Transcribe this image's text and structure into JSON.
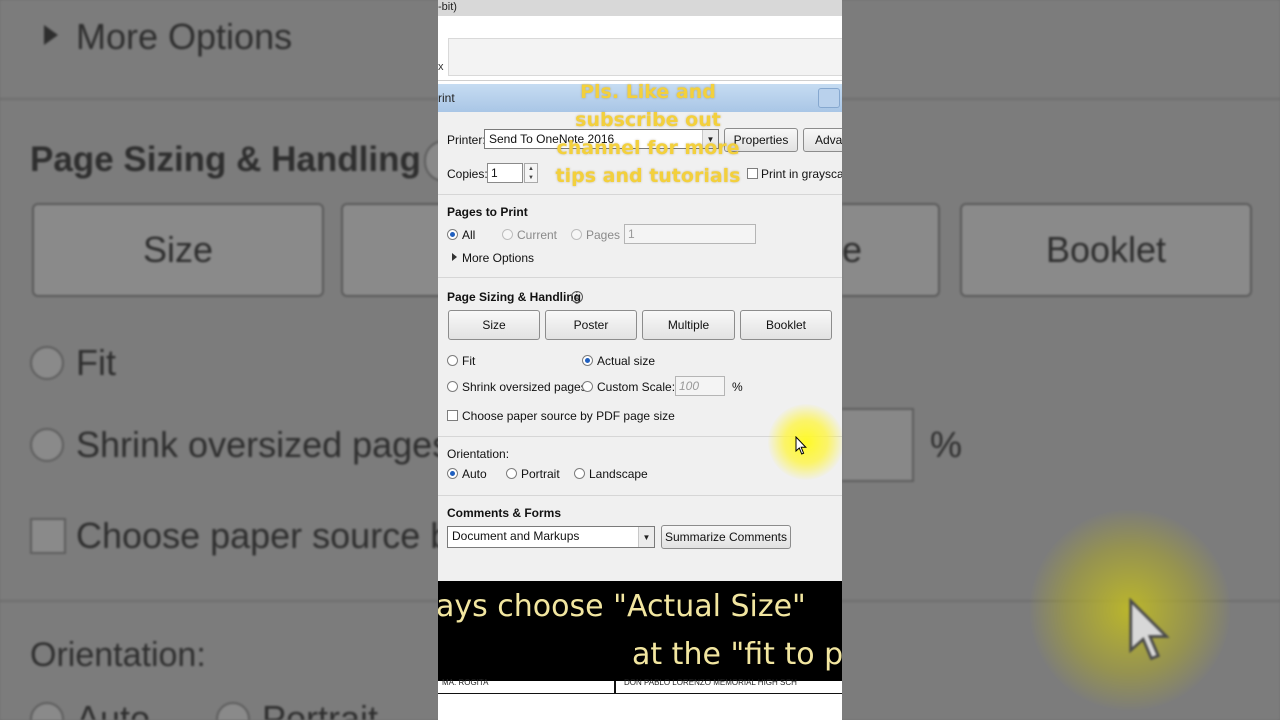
{
  "window": {
    "title_fragment": "-bit)",
    "toolbar_edge": "x"
  },
  "dialog": {
    "title_fragment": "rint",
    "printer": {
      "label": "Printer:",
      "value": "Send To OneNote 2016",
      "properties_label": "Properties",
      "advanced_label": "Adva"
    },
    "copies": {
      "label": "Copies:",
      "value": "1"
    },
    "grayscale_label": "Print in grayscale",
    "pages_to_print": {
      "heading": "Pages to Print",
      "all_label": "All",
      "current_label": "Current",
      "pages_label": "Pages",
      "pages_value": "1",
      "more_options_label": "More Options"
    },
    "page_sizing": {
      "heading": "Page Sizing & Handling",
      "info_glyph": "i",
      "buttons": [
        "Size",
        "Poster",
        "Multiple",
        "Booklet"
      ],
      "fit_label": "Fit",
      "actual_size_label": "Actual size",
      "shrink_label": "Shrink oversized pages",
      "custom_scale_label": "Custom Scale:",
      "custom_scale_value": "100",
      "percent": "%",
      "paper_source_label": "Choose paper source by PDF page size"
    },
    "orientation": {
      "heading": "Orientation:",
      "auto_label": "Auto",
      "portrait_label": "Portrait",
      "landscape_label": "Landscape"
    },
    "comments_forms": {
      "heading": "Comments & Forms",
      "value": "Document and Markups",
      "summarize_label": "Summarize Comments"
    }
  },
  "overlay": {
    "promo_text": "Pls. Like and subscribe out channel for more tips and tutorials"
  },
  "caption": {
    "line1": "ays choose \"Actual Size\"",
    "line2": "at the \"fit to p"
  },
  "page_footer": {
    "left": "MA. ROGITA",
    "right": "DON PABLO LORENZO MEMORIAL HIGH SCH"
  },
  "background": {
    "more_options": "More Options",
    "page_sizing_heading": "Page Sizing & Handling",
    "size_button": "Size",
    "booklet_button": "Booklet",
    "e_fragment": "e",
    "fit_label": "Fit",
    "shrink_label": "Shrink oversized pages",
    "percent": "%",
    "choose_label": "Choose paper source b",
    "orientation_heading": "Orientation:",
    "auto_label": "Auto",
    "portrait_label": "Portrait"
  },
  "colors": {
    "overlay_text": "#f3d03c",
    "caption_text": "#f2e6a0",
    "cursor_highlight": "#fff528",
    "title_bar": "#b5cfec",
    "radio_selected": "#1f5fbf"
  }
}
